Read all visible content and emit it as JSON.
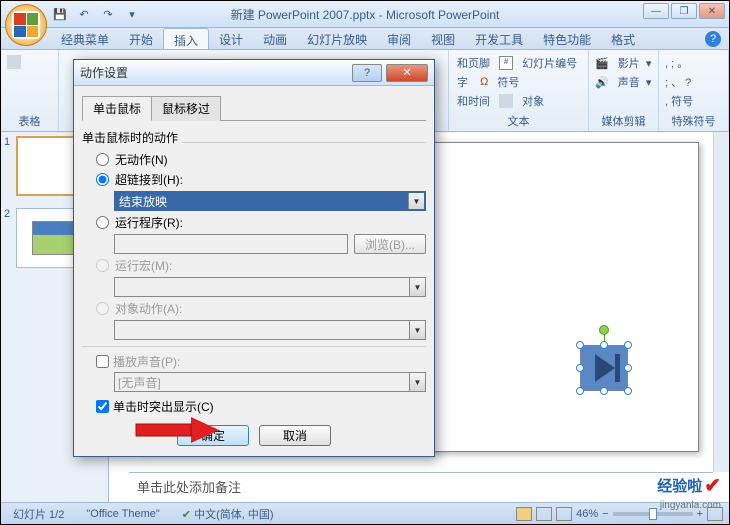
{
  "titlebar": {
    "title": "新建 PowerPoint 2007.pptx - Microsoft PowerPoint"
  },
  "ribbon": {
    "tabs": [
      "经典菜单",
      "开始",
      "插入",
      "设计",
      "动画",
      "幻灯片放映",
      "审阅",
      "视图",
      "开发工具",
      "特色功能",
      "格式"
    ],
    "active_tab": "插入",
    "groups": {
      "tables": {
        "label": "表格",
        "item": "表格"
      },
      "text": {
        "label": "文本",
        "items": [
          "和页脚",
          "幻灯片编号",
          "字",
          "符号",
          "和时间",
          "对象"
        ]
      },
      "media": {
        "label": "媒体剪辑",
        "items": [
          "影片",
          "声音"
        ]
      },
      "symbols": {
        "label": "特殊符号",
        "items": [
          ", ; 。",
          "; 、 ?",
          ", 符号"
        ]
      }
    }
  },
  "slides": {
    "panel_items": [
      {
        "num": "1",
        "selected": true
      },
      {
        "num": "2",
        "selected": false
      }
    ]
  },
  "notes": {
    "placeholder": "单击此处添加备注"
  },
  "statusbar": {
    "slide_info": "幻灯片 1/2",
    "theme": "\"Office Theme\"",
    "lang": "中文(简体, 中国)",
    "zoom": "46%"
  },
  "dialog": {
    "title": "动作设置",
    "tabs": [
      "单击鼠标",
      "鼠标移过"
    ],
    "active_tab": "单击鼠标",
    "section_label": "单击鼠标时的动作",
    "radio_none": "无动作(N)",
    "radio_hyperlink": "超链接到(H):",
    "hyperlink_value": "结束放映",
    "radio_run_program": "运行程序(R):",
    "browse_btn": "浏览(B)...",
    "radio_run_macro": "运行宏(M):",
    "radio_object_action": "对象动作(A):",
    "check_play_sound": "播放声音(P):",
    "sound_value": "[无声音]",
    "check_highlight": "单击时突出显示(C)",
    "ok": "确定",
    "cancel": "取消"
  },
  "watermark": {
    "text_cn": "经验啦",
    "url": "jingyanla.com"
  }
}
